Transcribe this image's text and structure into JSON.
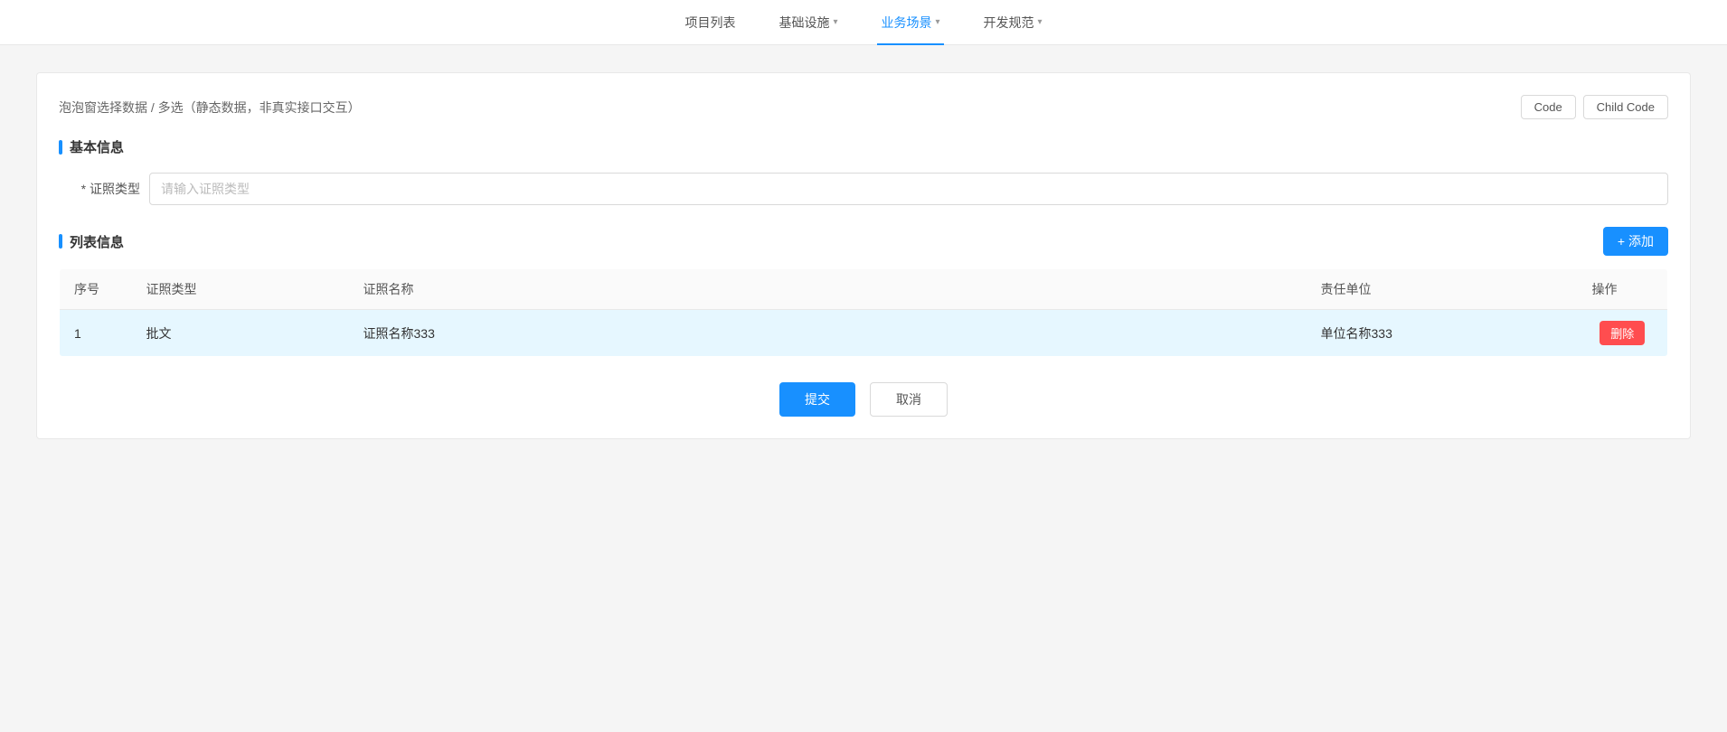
{
  "nav": {
    "items": [
      {
        "id": "project-list",
        "label": "项目列表",
        "active": false,
        "hasChevron": false
      },
      {
        "id": "infrastructure",
        "label": "基础设施",
        "active": false,
        "hasChevron": true
      },
      {
        "id": "business-scene",
        "label": "业务场景",
        "active": true,
        "hasChevron": true
      },
      {
        "id": "dev-spec",
        "label": "开发规范",
        "active": false,
        "hasChevron": true
      }
    ]
  },
  "card": {
    "header_title": "泡泡窗选择数据 / 多选（静态数据，非真实接口交互）",
    "code_button": "Code",
    "child_code_button": "Child Code"
  },
  "basic_info": {
    "section_title": "基本信息",
    "cert_type_label": "* 证照类型",
    "cert_type_placeholder": "请输入证照类型"
  },
  "list_info": {
    "section_title": "列表信息",
    "add_button": "+ 添加",
    "columns": [
      {
        "id": "index",
        "label": "序号"
      },
      {
        "id": "cert_type",
        "label": "证照类型"
      },
      {
        "id": "cert_name",
        "label": "证照名称"
      },
      {
        "id": "responsible_unit",
        "label": "责任单位"
      },
      {
        "id": "operation",
        "label": "操作"
      }
    ],
    "rows": [
      {
        "index": "1",
        "cert_type": "批文",
        "cert_name": "证照名称333",
        "responsible_unit": "单位名称333",
        "delete_label": "删除"
      }
    ]
  },
  "footer": {
    "submit_label": "提交",
    "cancel_label": "取消"
  }
}
